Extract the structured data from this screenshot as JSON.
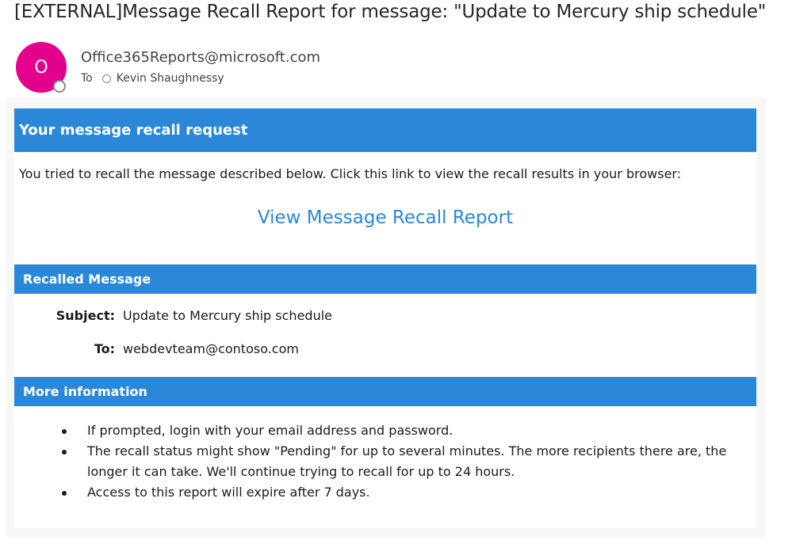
{
  "email": {
    "subject": "[EXTERNAL]Message Recall Report for message: \"Update to Mercury ship schedule\"",
    "avatar_initial": "O",
    "avatar_color": "#e3008c",
    "sender": "Office365Reports@microsoft.com",
    "to_label": "To",
    "recipient": "Kevin Shaughnessy"
  },
  "report": {
    "accent_color": "#2b88d8",
    "section_recall_title": "Your message recall request",
    "intro_text": "You tried to recall the message described below. Click this link to view the recall results in your browser:",
    "link_text": "View Message Recall Report",
    "section_recalled_title": "Recalled Message",
    "subject_label": "Subject:",
    "subject_value": "Update to Mercury ship schedule",
    "to_label": "To:",
    "to_value": "webdevteam@contoso.com",
    "section_more_title": "More information",
    "bullets": [
      "If prompted, login with your email address and password.",
      "The recall status might show \"Pending\" for up to several minutes. The more recipients there are, the longer it can take. We'll continue trying to recall for up to 24 hours.",
      "Access to this report will expire after 7 days."
    ]
  }
}
